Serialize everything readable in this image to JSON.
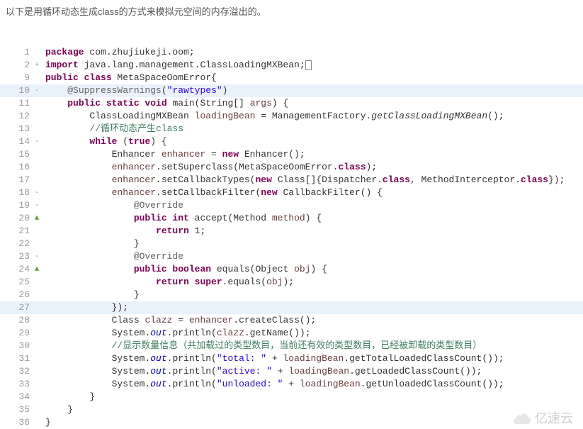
{
  "intro": "以下是用循环动态生成class的方式来模拟元空间的内存溢出的。",
  "watermark": "亿速云",
  "lines": [
    {
      "n": "1",
      "m": "",
      "tokens": [
        {
          "c": "kw",
          "t": "package"
        },
        {
          "t": " com.zhujiukeji.oom;"
        }
      ]
    },
    {
      "n": "2",
      "m": "+",
      "tokens": [
        {
          "c": "kw",
          "t": "import"
        },
        {
          "t": " java.lang.management.ClassLoadingMXBean;"
        },
        {
          "box": true
        }
      ]
    },
    {
      "n": "9",
      "m": "",
      "tokens": [
        {
          "c": "kw",
          "t": "public class"
        },
        {
          "t": " MetaSpaceOomError{"
        }
      ]
    },
    {
      "n": "10",
      "m": "-",
      "hl": true,
      "tokens": [
        {
          "t": "    "
        },
        {
          "c": "ann",
          "t": "@SuppressWarnings"
        },
        {
          "t": "("
        },
        {
          "c": "str",
          "t": "\"rawtypes\""
        },
        {
          "t": ")"
        }
      ]
    },
    {
      "n": "11",
      "m": "",
      "tokens": [
        {
          "t": "    "
        },
        {
          "c": "kw",
          "t": "public static void"
        },
        {
          "t": " main(String[] "
        },
        {
          "c": "var",
          "t": "args"
        },
        {
          "t": ") {"
        }
      ]
    },
    {
      "n": "12",
      "m": "",
      "tokens": [
        {
          "t": "        ClassLoadingMXBean "
        },
        {
          "c": "var",
          "t": "loadingBean"
        },
        {
          "t": " = ManagementFactory."
        },
        {
          "c": "smeth",
          "t": "getClassLoadingMXBean"
        },
        {
          "t": "();"
        }
      ]
    },
    {
      "n": "13",
      "m": "",
      "tokens": [
        {
          "t": "        "
        },
        {
          "c": "cmt",
          "t": "//循环动态产生class"
        }
      ]
    },
    {
      "n": "14",
      "m": "-",
      "tokens": [
        {
          "t": "        "
        },
        {
          "c": "kw",
          "t": "while"
        },
        {
          "t": " ("
        },
        {
          "c": "kw",
          "t": "true"
        },
        {
          "t": ") {"
        }
      ]
    },
    {
      "n": "15",
      "m": "",
      "tokens": [
        {
          "t": "            Enhancer "
        },
        {
          "c": "var",
          "t": "enhancer"
        },
        {
          "t": " = "
        },
        {
          "c": "kw",
          "t": "new"
        },
        {
          "t": " Enhancer();"
        }
      ]
    },
    {
      "n": "16",
      "m": "",
      "tokens": [
        {
          "t": "            "
        },
        {
          "c": "var",
          "t": "enhancer"
        },
        {
          "t": ".setSuperclass(MetaSpaceOomError."
        },
        {
          "c": "kw",
          "t": "class"
        },
        {
          "t": ");"
        }
      ]
    },
    {
      "n": "17",
      "m": "",
      "tokens": [
        {
          "t": "            "
        },
        {
          "c": "var",
          "t": "enhancer"
        },
        {
          "t": ".setCallbackTypes("
        },
        {
          "c": "kw",
          "t": "new"
        },
        {
          "t": " Class[]{Dispatcher."
        },
        {
          "c": "kw",
          "t": "class"
        },
        {
          "t": ", MethodInterceptor."
        },
        {
          "c": "kw",
          "t": "class"
        },
        {
          "t": "});"
        }
      ]
    },
    {
      "n": "18",
      "m": "-",
      "tokens": [
        {
          "t": "            "
        },
        {
          "c": "var",
          "t": "enhancer"
        },
        {
          "t": ".setCallbackFilter("
        },
        {
          "c": "kw",
          "t": "new"
        },
        {
          "t": " CallbackFilter() {"
        }
      ]
    },
    {
      "n": "19",
      "m": "-",
      "tokens": [
        {
          "t": "                "
        },
        {
          "c": "ann",
          "t": "@Override"
        }
      ]
    },
    {
      "n": "20",
      "m": "▲",
      "mt": "tri",
      "tokens": [
        {
          "t": "                "
        },
        {
          "c": "kw",
          "t": "public int"
        },
        {
          "t": " accept(Method "
        },
        {
          "c": "var",
          "t": "method"
        },
        {
          "t": ") {"
        }
      ]
    },
    {
      "n": "21",
      "m": "",
      "tokens": [
        {
          "t": "                    "
        },
        {
          "c": "kw",
          "t": "return"
        },
        {
          "t": " 1;"
        }
      ]
    },
    {
      "n": "22",
      "m": "",
      "tokens": [
        {
          "t": "                }"
        }
      ]
    },
    {
      "n": "23",
      "m": "-",
      "tokens": [
        {
          "t": "                "
        },
        {
          "c": "ann",
          "t": "@Override"
        }
      ]
    },
    {
      "n": "24",
      "m": "▲",
      "mt": "tri",
      "tokens": [
        {
          "t": "                "
        },
        {
          "c": "kw",
          "t": "public boolean"
        },
        {
          "t": " equals(Object "
        },
        {
          "c": "var",
          "t": "obj"
        },
        {
          "t": ") {"
        }
      ]
    },
    {
      "n": "25",
      "m": "",
      "tokens": [
        {
          "t": "                    "
        },
        {
          "c": "kw",
          "t": "return super"
        },
        {
          "t": ".equals("
        },
        {
          "c": "var",
          "t": "obj"
        },
        {
          "t": ");"
        }
      ]
    },
    {
      "n": "26",
      "m": "",
      "tokens": [
        {
          "t": "                }"
        }
      ]
    },
    {
      "n": "27",
      "m": "",
      "hl": true,
      "tokens": [
        {
          "t": "            });"
        }
      ]
    },
    {
      "n": "28",
      "m": "",
      "tokens": [
        {
          "t": "            Class "
        },
        {
          "c": "var",
          "t": "clazz"
        },
        {
          "t": " = "
        },
        {
          "c": "var",
          "t": "enhancer"
        },
        {
          "t": ".createClass();"
        }
      ]
    },
    {
      "n": "29",
      "m": "",
      "tokens": [
        {
          "t": "            System."
        },
        {
          "c": "fld",
          "t": "out"
        },
        {
          "t": ".println("
        },
        {
          "c": "var",
          "t": "clazz"
        },
        {
          "t": ".getName());"
        }
      ]
    },
    {
      "n": "30",
      "m": "",
      "tokens": [
        {
          "t": "            "
        },
        {
          "c": "cmt",
          "t": "//显示数量信息（共加载过的类型数目，当前还有效的类型数目，已经被卸载的类型数目）"
        }
      ]
    },
    {
      "n": "31",
      "m": "",
      "tokens": [
        {
          "t": "            System."
        },
        {
          "c": "fld",
          "t": "out"
        },
        {
          "t": ".println("
        },
        {
          "c": "str",
          "t": "\"total: \""
        },
        {
          "t": " + "
        },
        {
          "c": "var",
          "t": "loadingBean"
        },
        {
          "t": ".getTotalLoadedClassCount());"
        }
      ]
    },
    {
      "n": "32",
      "m": "",
      "tokens": [
        {
          "t": "            System."
        },
        {
          "c": "fld",
          "t": "out"
        },
        {
          "t": ".println("
        },
        {
          "c": "str",
          "t": "\"active: \""
        },
        {
          "t": " + "
        },
        {
          "c": "var",
          "t": "loadingBean"
        },
        {
          "t": ".getLoadedClassCount());"
        }
      ]
    },
    {
      "n": "33",
      "m": "",
      "tokens": [
        {
          "t": "            System."
        },
        {
          "c": "fld",
          "t": "out"
        },
        {
          "t": ".println("
        },
        {
          "c": "str",
          "t": "\"unloaded: \""
        },
        {
          "t": " + "
        },
        {
          "c": "var",
          "t": "loadingBean"
        },
        {
          "t": ".getUnloadedClassCount());"
        }
      ]
    },
    {
      "n": "34",
      "m": "",
      "tokens": [
        {
          "t": "        }"
        }
      ]
    },
    {
      "n": "35",
      "m": "",
      "tokens": [
        {
          "t": "    }"
        }
      ]
    },
    {
      "n": "36",
      "m": "",
      "tokens": [
        {
          "t": "}"
        }
      ]
    }
  ]
}
